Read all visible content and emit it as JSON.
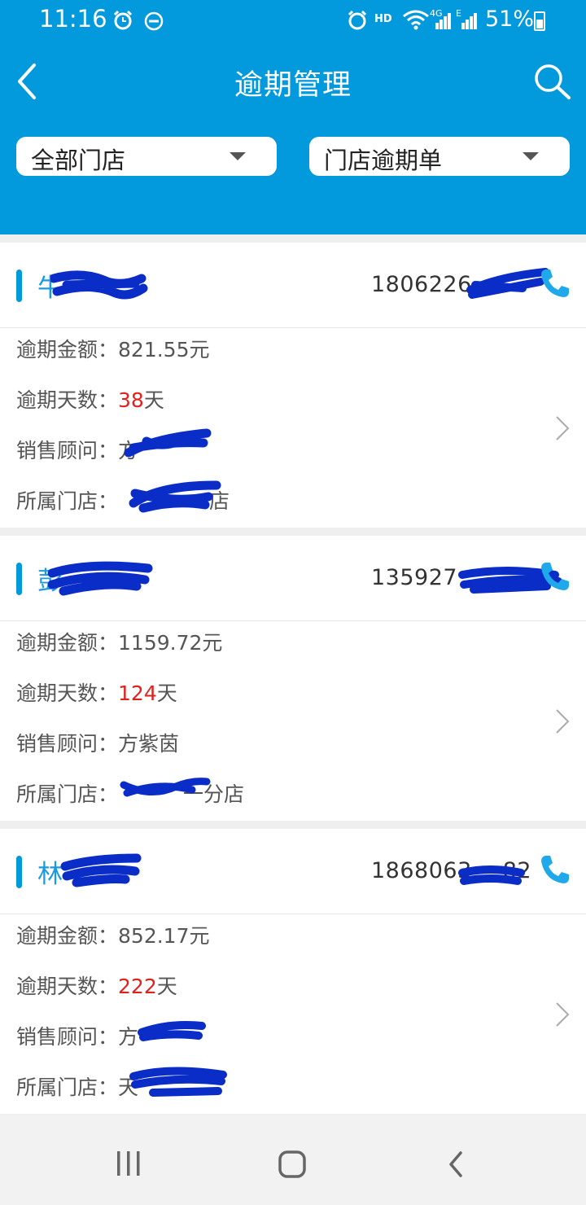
{
  "status_bar": {
    "time": "11:16",
    "network": "HD",
    "signal_4g": "4G",
    "signal_e": "E",
    "battery": "51%"
  },
  "header": {
    "title": "逾期管理"
  },
  "filters": {
    "store": "全部门店",
    "type": "门店逾期单"
  },
  "labels": {
    "amount": "逾期金额：",
    "days": "逾期天数：",
    "advisor": "销售顾问：",
    "store": "所属门店："
  },
  "records": [
    {
      "name": "牛",
      "phone": "1806226",
      "amount": "821.55元",
      "days_value": "38",
      "days_unit": "天",
      "advisor": "方",
      "store": "店"
    },
    {
      "name": "彭",
      "phone": "135927",
      "amount": "1159.72元",
      "days_value": "124",
      "days_unit": "天",
      "advisor": "方紫茵",
      "store": "一分店"
    },
    {
      "name": "林",
      "phone": "1868063",
      "phone_tail": "82",
      "amount": "852.17元",
      "days_value": "222",
      "days_unit": "天",
      "advisor": "方",
      "store": "天"
    }
  ],
  "colors": {
    "primary": "#0299dd",
    "name_blue": "#1a9be0",
    "overdue_red": "#e0211e",
    "redaction": "#0a2cc7"
  }
}
